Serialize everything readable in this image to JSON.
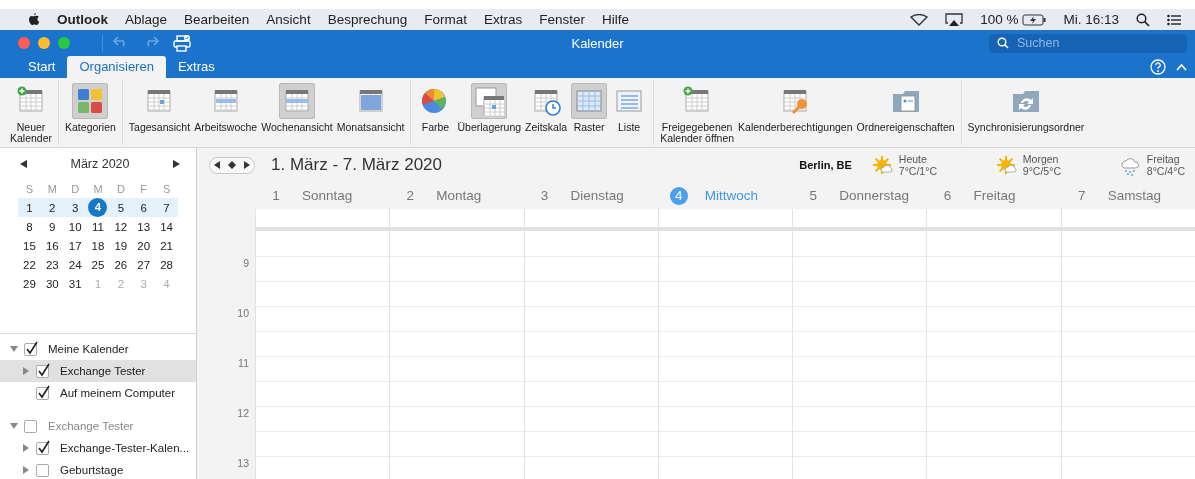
{
  "menu_bar": {
    "app": "Outlook",
    "items": [
      "Ablage",
      "Bearbeiten",
      "Ansicht",
      "Besprechung",
      "Format",
      "Extras",
      "Fenster",
      "Hilfe"
    ],
    "battery": "100 %",
    "clock": "Mi. 16:13"
  },
  "window": {
    "title": "Kalender"
  },
  "search": {
    "placeholder": "Suchen"
  },
  "tabs": [
    {
      "label": "Start",
      "selected": false
    },
    {
      "label": "Organisieren",
      "selected": true
    },
    {
      "label": "Extras",
      "selected": false
    }
  ],
  "ribbon": {
    "groups": [
      [
        {
          "label": "Neuer\nKalender",
          "kind": "new-calendar",
          "selected": false
        }
      ],
      [
        {
          "label": "Kategorien",
          "kind": "categories",
          "selected": true
        }
      ],
      [
        {
          "label": "Tagesansicht",
          "kind": "day",
          "selected": false
        },
        {
          "label": "Arbeitswoche",
          "kind": "workweek",
          "selected": false
        },
        {
          "label": "Wochenansicht",
          "kind": "week",
          "selected": true
        },
        {
          "label": "Monatsansicht",
          "kind": "month",
          "selected": false
        }
      ],
      [
        {
          "label": "Farbe",
          "kind": "color",
          "selected": false
        },
        {
          "label": "Überlagerung",
          "kind": "overlay",
          "selected": true
        },
        {
          "label": "Zeitskala",
          "kind": "timescale",
          "selected": false
        },
        {
          "label": "Raster",
          "kind": "grid",
          "selected": true
        },
        {
          "label": "Liste",
          "kind": "list",
          "selected": false
        }
      ],
      [
        {
          "label": "Freigegebenen\nKalender öffnen",
          "kind": "shared",
          "selected": false
        },
        {
          "label": "Kalenderberechtigungen",
          "kind": "permissions",
          "selected": false
        },
        {
          "label": "Ordnereigenschaften",
          "kind": "folder",
          "selected": false
        }
      ],
      [
        {
          "label": "Synchronisierungsordner",
          "kind": "sync",
          "selected": false
        }
      ]
    ]
  },
  "mini_calendar": {
    "month": "März 2020",
    "weekdays": [
      "S",
      "M",
      "D",
      "M",
      "D",
      "F",
      "S"
    ],
    "weeks": [
      {
        "selected": true,
        "days": [
          {
            "day": "1",
            "muted": false,
            "today": false
          },
          {
            "day": "2",
            "muted": false,
            "today": false
          },
          {
            "day": "3",
            "muted": false,
            "today": false
          },
          {
            "day": "4",
            "muted": false,
            "today": true
          },
          {
            "day": "5",
            "muted": false,
            "today": false
          },
          {
            "day": "6",
            "muted": false,
            "today": false
          },
          {
            "day": "7",
            "muted": false,
            "today": false
          }
        ]
      },
      {
        "selected": false,
        "days": [
          {
            "day": "8",
            "muted": false,
            "today": false
          },
          {
            "day": "9",
            "muted": false,
            "today": false
          },
          {
            "day": "10",
            "muted": false,
            "today": false
          },
          {
            "day": "11",
            "muted": false,
            "today": false
          },
          {
            "day": "12",
            "muted": false,
            "today": false
          },
          {
            "day": "13",
            "muted": false,
            "today": false
          },
          {
            "day": "14",
            "muted": false,
            "today": false
          }
        ]
      },
      {
        "selected": false,
        "days": [
          {
            "day": "15",
            "muted": false,
            "today": false
          },
          {
            "day": "16",
            "muted": false,
            "today": false
          },
          {
            "day": "17",
            "muted": false,
            "today": false
          },
          {
            "day": "18",
            "muted": false,
            "today": false
          },
          {
            "day": "19",
            "muted": false,
            "today": false
          },
          {
            "day": "20",
            "muted": false,
            "today": false
          },
          {
            "day": "21",
            "muted": false,
            "today": false
          }
        ]
      },
      {
        "selected": false,
        "days": [
          {
            "day": "22",
            "muted": false,
            "today": false
          },
          {
            "day": "23",
            "muted": false,
            "today": false
          },
          {
            "day": "24",
            "muted": false,
            "today": false
          },
          {
            "day": "25",
            "muted": false,
            "today": false
          },
          {
            "day": "26",
            "muted": false,
            "today": false
          },
          {
            "day": "27",
            "muted": false,
            "today": false
          },
          {
            "day": "28",
            "muted": false,
            "today": false
          }
        ]
      },
      {
        "selected": false,
        "days": [
          {
            "day": "29",
            "muted": false,
            "today": false
          },
          {
            "day": "30",
            "muted": false,
            "today": false
          },
          {
            "day": "31",
            "muted": false,
            "today": false
          },
          {
            "day": "1",
            "muted": true,
            "today": false
          },
          {
            "day": "2",
            "muted": true,
            "today": false
          },
          {
            "day": "3",
            "muted": true,
            "today": false
          },
          {
            "day": "4",
            "muted": true,
            "today": false
          }
        ]
      }
    ]
  },
  "calendars": [
    {
      "label": "Meine Kalender",
      "checked": true,
      "expanded": true,
      "disabled": false,
      "selected": false,
      "children": [
        {
          "label": "Exchange Tester",
          "checked": true,
          "expanded": false,
          "disabled": false,
          "selected": true
        },
        {
          "label": "Auf meinem Computer",
          "checked": true,
          "disabled": false,
          "selected": false
        }
      ]
    },
    {
      "label": "Exchange Tester",
      "checked": false,
      "expanded": true,
      "disabled": true,
      "selected": false,
      "children": [
        {
          "label": "Exchange-Tester-Kalen...",
          "checked": true,
          "expanded": false,
          "disabled": false,
          "selected": false
        },
        {
          "label": "Geburtstage",
          "checked": false,
          "expanded": false,
          "disabled": false,
          "selected": false
        }
      ]
    }
  ],
  "week_view": {
    "range": "1. März - 7. März 2020",
    "location": "Berlin, BE",
    "weather": [
      {
        "day": "Heute",
        "temps": "7°C/1°C",
        "kind": "sun-cloud"
      },
      {
        "day": "Morgen",
        "temps": "9°C/5°C",
        "kind": "sun-cloud"
      },
      {
        "day": "Freitag",
        "temps": "8°C/4°C",
        "kind": "rain"
      }
    ],
    "days": [
      {
        "number": "1",
        "name": "Sonntag",
        "today": false
      },
      {
        "number": "2",
        "name": "Montag",
        "today": false
      },
      {
        "number": "3",
        "name": "Dienstag",
        "today": false
      },
      {
        "number": "4",
        "name": "Mittwoch",
        "today": true
      },
      {
        "number": "5",
        "name": "Donnerstag",
        "today": false
      },
      {
        "number": "6",
        "name": "Freitag",
        "today": false
      },
      {
        "number": "7",
        "name": "Samstag",
        "today": false
      }
    ],
    "hours": [
      "9",
      "10",
      "11",
      "12",
      "13"
    ]
  }
}
